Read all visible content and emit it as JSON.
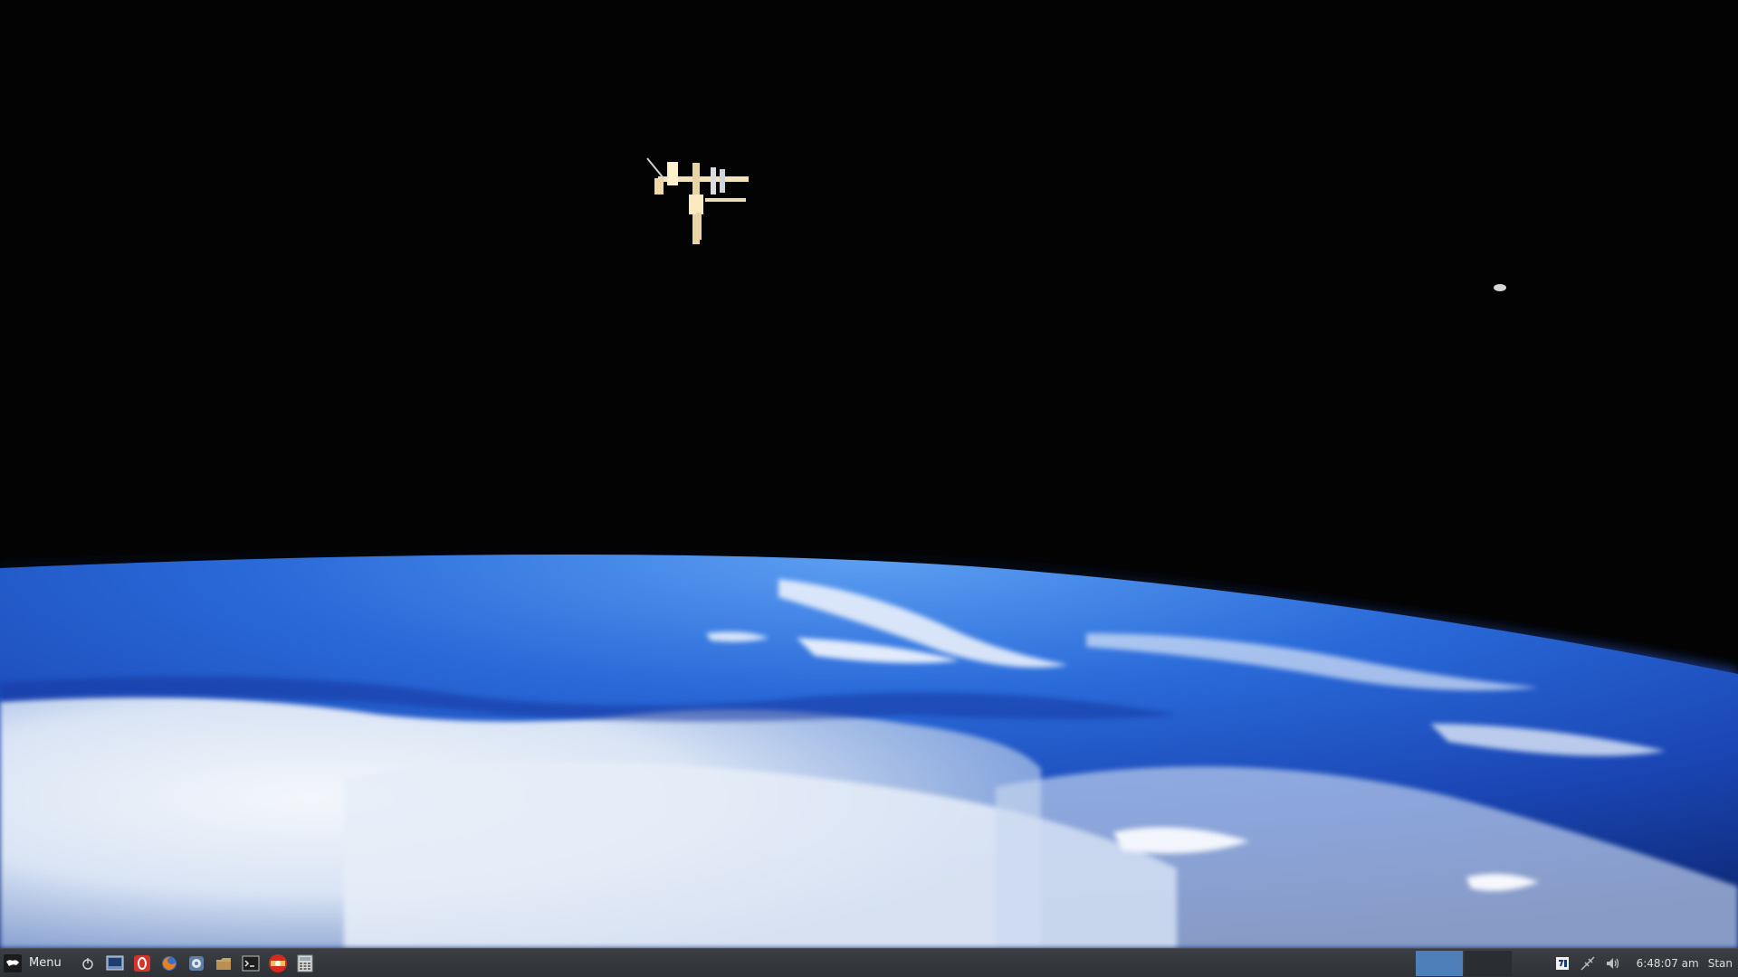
{
  "panel": {
    "menu_label": "Menu",
    "launchers": [
      {
        "name": "shutdown-icon"
      },
      {
        "name": "monitor-icon"
      },
      {
        "name": "opera-icon"
      },
      {
        "name": "firefox-icon"
      },
      {
        "name": "system-settings-icon"
      },
      {
        "name": "folder-icon"
      },
      {
        "name": "terminal-icon"
      },
      {
        "name": "media-icon"
      },
      {
        "name": "calculator-icon"
      }
    ],
    "workspaces": [
      {
        "active": true
      },
      {
        "active": false
      }
    ],
    "tray": {
      "icons": [
        "updates-icon",
        "network-icon",
        "volume-icon"
      ],
      "clock": "6:48:07 am",
      "user": "Stan"
    }
  },
  "colors": {
    "panel_bg": "#33373b",
    "workspace_active": "#4f7fb9",
    "space": "#030303",
    "earth_blue": "#2f6fd6",
    "clouds": "#e8eef8"
  }
}
